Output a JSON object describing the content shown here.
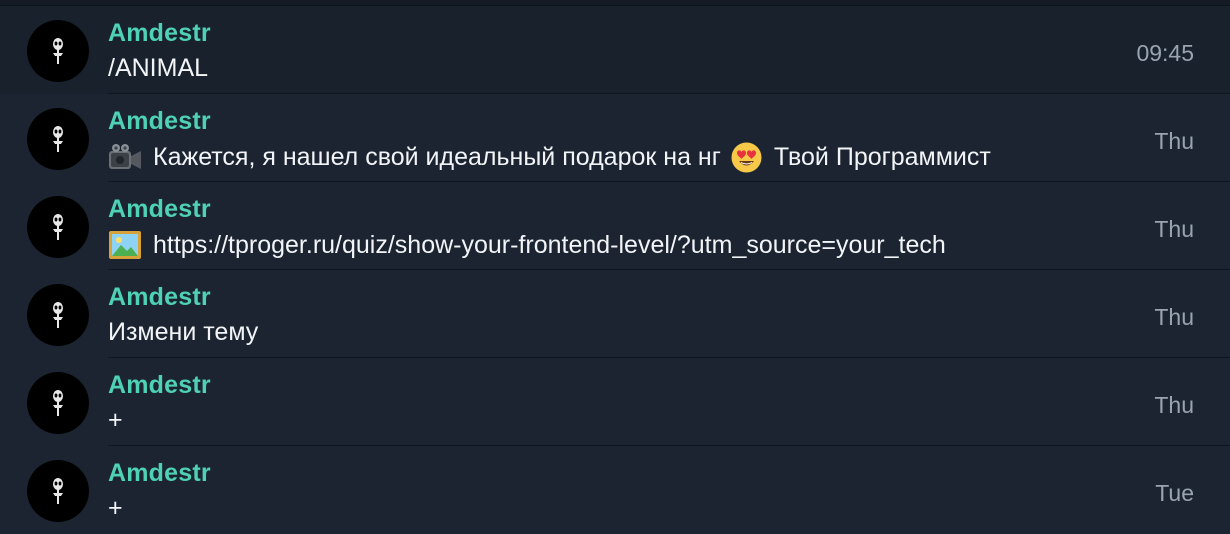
{
  "chats": [
    {
      "sender": "Amdestr",
      "message": "/ANIMAL",
      "time": "09:45",
      "avatar_icon": "alien-icon"
    },
    {
      "sender": "Amdestr",
      "media_icon": "video-camera-icon",
      "message_before_emoji": "Кажется, я нашел свой идеальный подарок на нг",
      "emoji_icon": "heart-eyes-emoji-icon",
      "message_after_emoji": "Твой Программист",
      "time": "Thu",
      "avatar_icon": "alien-icon"
    },
    {
      "sender": "Amdestr",
      "media_icon": "picture-icon",
      "message": "https://tproger.ru/quiz/show-your-frontend-level/?utm_source=your_tech",
      "time": "Thu",
      "avatar_icon": "alien-icon"
    },
    {
      "sender": "Amdestr",
      "message": "Измени тему",
      "time": "Thu",
      "avatar_icon": "alien-icon"
    },
    {
      "sender": "Amdestr",
      "message": "+",
      "time": "Thu",
      "avatar_icon": "alien-icon"
    },
    {
      "sender": "Amdestr",
      "message": "+",
      "time": "Tue",
      "avatar_icon": "alien-icon"
    }
  ],
  "colors": {
    "background": "#1b2430",
    "sender_name": "#4fd1b5",
    "message_text": "#f2f4f7",
    "time_text": "#9aa4b1",
    "avatar_bg": "#000000"
  }
}
